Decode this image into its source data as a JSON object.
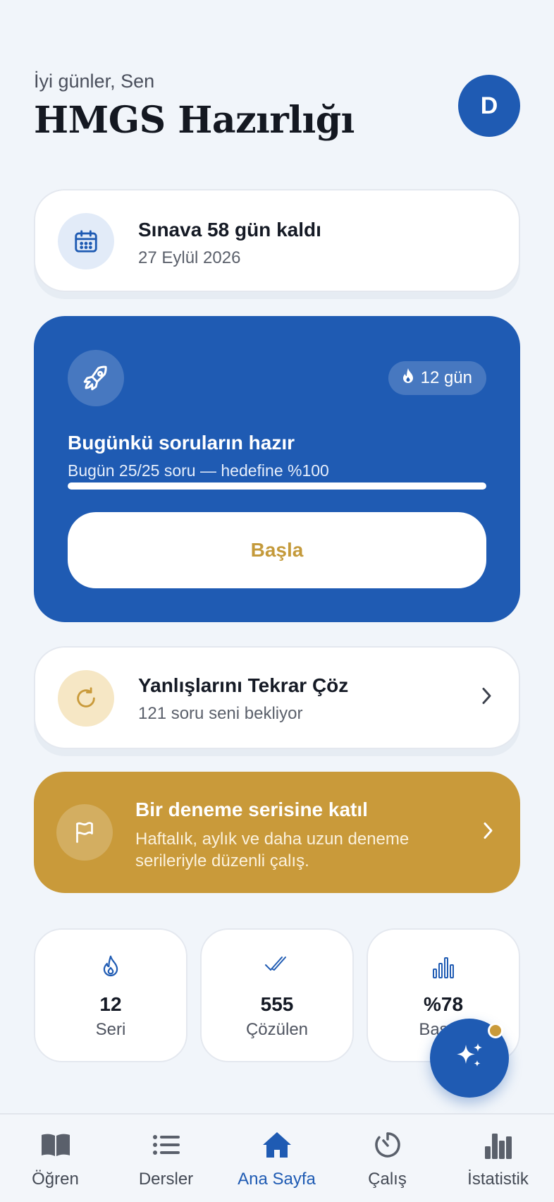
{
  "header": {
    "greeting": "İyi günler, Sen",
    "title": "HMGS Hazırlığı",
    "avatar_initial": "D"
  },
  "exam_card": {
    "icon": "calendar-icon",
    "title": "Sınava 58 gün kaldı",
    "date": "27 Eylül 2026"
  },
  "daily_card": {
    "icon": "rocket-icon",
    "streak": "12 gün",
    "title": "Bugünkü soruların hazır",
    "subtitle": "Bugün 25/25 soru — hedefine %100",
    "progress_fraction": 1.0,
    "start_label": "Başla"
  },
  "wrong_card": {
    "icon": "retry-icon",
    "title": "Yanlışlarını Tekrar Çöz",
    "subtitle": "121 soru seni bekliyor"
  },
  "series_card": {
    "icon": "flag-icon",
    "title": "Bir deneme serisine katıl",
    "subtitle": "Haftalık, aylık ve daha uzun deneme serileriyle düzenli çalış."
  },
  "stats": [
    {
      "icon": "flame-icon",
      "value": "12",
      "label": "Seri"
    },
    {
      "icon": "double-check-icon",
      "value": "555",
      "label": "Çözülen"
    },
    {
      "icon": "bar-chart-icon",
      "value": "%78",
      "label": "Başarı"
    }
  ],
  "nav": [
    {
      "icon": "book-icon",
      "label": "Öğren"
    },
    {
      "icon": "list-icon",
      "label": "Dersler"
    },
    {
      "icon": "home-icon",
      "label": "Ana Sayfa",
      "active": true
    },
    {
      "icon": "timer-icon",
      "label": "Çalış"
    },
    {
      "icon": "stats-icon",
      "label": "İstatistik"
    }
  ],
  "colors": {
    "primary": "#1f5bb3",
    "gold": "#c99a3a",
    "background": "#f1f5fa"
  }
}
